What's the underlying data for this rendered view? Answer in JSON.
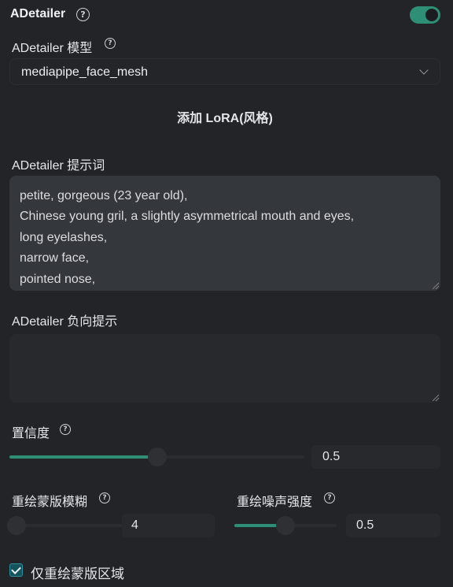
{
  "header": {
    "title": "ADetailer",
    "enabled": true
  },
  "model": {
    "label": "ADetailer 模型",
    "selected": "mediapipe_face_mesh"
  },
  "lora_button": {
    "label": "添加 LoRA(风格)"
  },
  "prompt": {
    "label": "ADetailer 提示词",
    "lines": [
      "petite, gorgeous (23 year old),",
      "Chinese young gril, a slightly asymmetrical mouth and eyes,",
      "long eyelashes,",
      "narrow face,",
      "pointed nose,"
    ]
  },
  "negative_prompt": {
    "label": "ADetailer 负向提示",
    "value": ""
  },
  "confidence": {
    "label": "置信度",
    "value": "0.5",
    "fraction": 0.5
  },
  "mask_blur": {
    "label": "重绘蒙版模糊",
    "value": "4",
    "fraction": 0.06
  },
  "denoise": {
    "label": "重绘噪声强度",
    "value": "0.5",
    "fraction": 0.5
  },
  "inpaint_only_masked": {
    "label": "仅重绘蒙版区域",
    "checked": true
  },
  "colors": {
    "accent": "#2f8f76",
    "background": "#232427"
  }
}
